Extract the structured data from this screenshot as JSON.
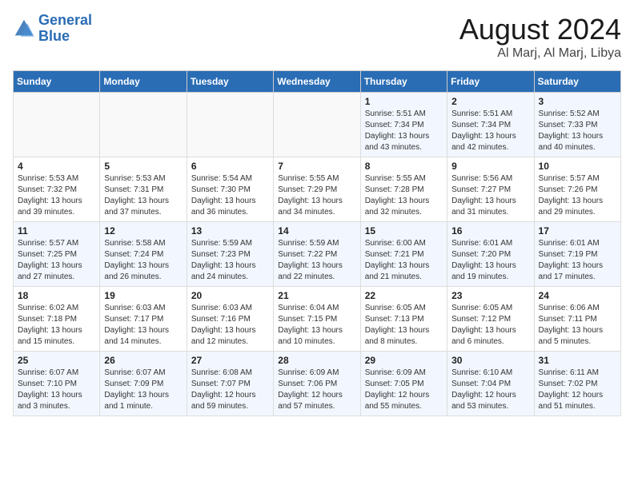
{
  "logo": {
    "line1": "General",
    "line2": "Blue"
  },
  "title": "August 2024",
  "subtitle": "Al Marj, Al Marj, Libya",
  "days_of_week": [
    "Sunday",
    "Monday",
    "Tuesday",
    "Wednesday",
    "Thursday",
    "Friday",
    "Saturday"
  ],
  "weeks": [
    [
      {
        "day": "",
        "info": ""
      },
      {
        "day": "",
        "info": ""
      },
      {
        "day": "",
        "info": ""
      },
      {
        "day": "",
        "info": ""
      },
      {
        "day": "1",
        "info": "Sunrise: 5:51 AM\nSunset: 7:34 PM\nDaylight: 13 hours\nand 43 minutes."
      },
      {
        "day": "2",
        "info": "Sunrise: 5:51 AM\nSunset: 7:34 PM\nDaylight: 13 hours\nand 42 minutes."
      },
      {
        "day": "3",
        "info": "Sunrise: 5:52 AM\nSunset: 7:33 PM\nDaylight: 13 hours\nand 40 minutes."
      }
    ],
    [
      {
        "day": "4",
        "info": "Sunrise: 5:53 AM\nSunset: 7:32 PM\nDaylight: 13 hours\nand 39 minutes."
      },
      {
        "day": "5",
        "info": "Sunrise: 5:53 AM\nSunset: 7:31 PM\nDaylight: 13 hours\nand 37 minutes."
      },
      {
        "day": "6",
        "info": "Sunrise: 5:54 AM\nSunset: 7:30 PM\nDaylight: 13 hours\nand 36 minutes."
      },
      {
        "day": "7",
        "info": "Sunrise: 5:55 AM\nSunset: 7:29 PM\nDaylight: 13 hours\nand 34 minutes."
      },
      {
        "day": "8",
        "info": "Sunrise: 5:55 AM\nSunset: 7:28 PM\nDaylight: 13 hours\nand 32 minutes."
      },
      {
        "day": "9",
        "info": "Sunrise: 5:56 AM\nSunset: 7:27 PM\nDaylight: 13 hours\nand 31 minutes."
      },
      {
        "day": "10",
        "info": "Sunrise: 5:57 AM\nSunset: 7:26 PM\nDaylight: 13 hours\nand 29 minutes."
      }
    ],
    [
      {
        "day": "11",
        "info": "Sunrise: 5:57 AM\nSunset: 7:25 PM\nDaylight: 13 hours\nand 27 minutes."
      },
      {
        "day": "12",
        "info": "Sunrise: 5:58 AM\nSunset: 7:24 PM\nDaylight: 13 hours\nand 26 minutes."
      },
      {
        "day": "13",
        "info": "Sunrise: 5:59 AM\nSunset: 7:23 PM\nDaylight: 13 hours\nand 24 minutes."
      },
      {
        "day": "14",
        "info": "Sunrise: 5:59 AM\nSunset: 7:22 PM\nDaylight: 13 hours\nand 22 minutes."
      },
      {
        "day": "15",
        "info": "Sunrise: 6:00 AM\nSunset: 7:21 PM\nDaylight: 13 hours\nand 21 minutes."
      },
      {
        "day": "16",
        "info": "Sunrise: 6:01 AM\nSunset: 7:20 PM\nDaylight: 13 hours\nand 19 minutes."
      },
      {
        "day": "17",
        "info": "Sunrise: 6:01 AM\nSunset: 7:19 PM\nDaylight: 13 hours\nand 17 minutes."
      }
    ],
    [
      {
        "day": "18",
        "info": "Sunrise: 6:02 AM\nSunset: 7:18 PM\nDaylight: 13 hours\nand 15 minutes."
      },
      {
        "day": "19",
        "info": "Sunrise: 6:03 AM\nSunset: 7:17 PM\nDaylight: 13 hours\nand 14 minutes."
      },
      {
        "day": "20",
        "info": "Sunrise: 6:03 AM\nSunset: 7:16 PM\nDaylight: 13 hours\nand 12 minutes."
      },
      {
        "day": "21",
        "info": "Sunrise: 6:04 AM\nSunset: 7:15 PM\nDaylight: 13 hours\nand 10 minutes."
      },
      {
        "day": "22",
        "info": "Sunrise: 6:05 AM\nSunset: 7:13 PM\nDaylight: 13 hours\nand 8 minutes."
      },
      {
        "day": "23",
        "info": "Sunrise: 6:05 AM\nSunset: 7:12 PM\nDaylight: 13 hours\nand 6 minutes."
      },
      {
        "day": "24",
        "info": "Sunrise: 6:06 AM\nSunset: 7:11 PM\nDaylight: 13 hours\nand 5 minutes."
      }
    ],
    [
      {
        "day": "25",
        "info": "Sunrise: 6:07 AM\nSunset: 7:10 PM\nDaylight: 13 hours\nand 3 minutes."
      },
      {
        "day": "26",
        "info": "Sunrise: 6:07 AM\nSunset: 7:09 PM\nDaylight: 13 hours\nand 1 minute."
      },
      {
        "day": "27",
        "info": "Sunrise: 6:08 AM\nSunset: 7:07 PM\nDaylight: 12 hours\nand 59 minutes."
      },
      {
        "day": "28",
        "info": "Sunrise: 6:09 AM\nSunset: 7:06 PM\nDaylight: 12 hours\nand 57 minutes."
      },
      {
        "day": "29",
        "info": "Sunrise: 6:09 AM\nSunset: 7:05 PM\nDaylight: 12 hours\nand 55 minutes."
      },
      {
        "day": "30",
        "info": "Sunrise: 6:10 AM\nSunset: 7:04 PM\nDaylight: 12 hours\nand 53 minutes."
      },
      {
        "day": "31",
        "info": "Sunrise: 6:11 AM\nSunset: 7:02 PM\nDaylight: 12 hours\nand 51 minutes."
      }
    ]
  ]
}
